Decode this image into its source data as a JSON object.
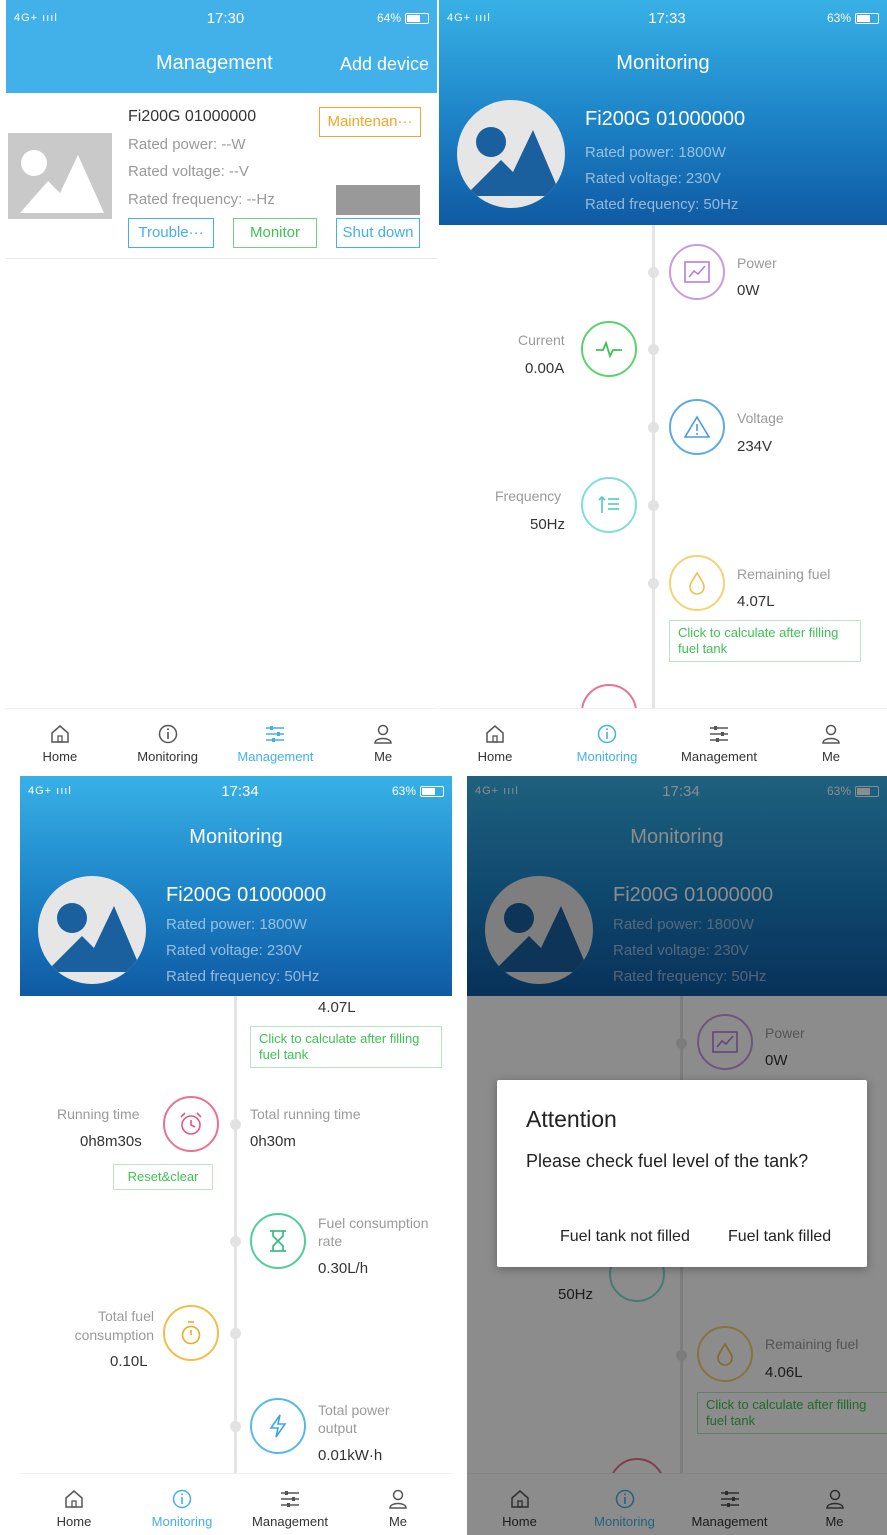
{
  "status": {
    "p1": {
      "signal": "4G+ ıııl",
      "time": "17:30",
      "battery": "64%"
    },
    "p2": {
      "signal": "4G+ ıııl",
      "time": "17:33",
      "battery": "63%"
    },
    "p3": {
      "signal": "4G+ ıııl",
      "time": "17:34",
      "battery": "63%"
    },
    "p4": {
      "signal": "4G+ ıııl",
      "time": "17:34",
      "battery": "63%"
    }
  },
  "colors": {
    "accent": "#42b1ea",
    "orange": "#f5a623",
    "green": "#3fc154"
  },
  "tabs": [
    "Home",
    "Monitoring",
    "Management",
    "Me"
  ],
  "management": {
    "title": "Management",
    "add_device": "Add device",
    "device_name": "Fi200G 01000000",
    "rated_power": "Rated power:  --W",
    "rated_voltage": "Rated voltage:  --V",
    "rated_frequency": "Rated frequency:  --Hz",
    "btn_maintenance": "Maintenan···",
    "btn_trouble": "Trouble···",
    "btn_monitor": "Monitor",
    "btn_shutdown": "Shut down"
  },
  "monitoring": {
    "title": "Monitoring",
    "device_name": "Fi200G 01000000",
    "rated_power": "Rated power:  1800W",
    "rated_voltage": "Rated voltage:  230V",
    "rated_frequency": "Rated frequency:  50Hz",
    "power_label": "Power",
    "power_value": "0W",
    "current_label": "Current",
    "current_value": "0.00A",
    "voltage_label": "Voltage",
    "voltage_value": "234V",
    "frequency_label": "Frequency",
    "frequency_value": "50Hz",
    "fuel_label": "Remaining fuel",
    "fuel_value": "4.07L",
    "fuel_value_p4": "4.06L",
    "calc_btn": "Click to calculate after filling fuel tank",
    "running_label": "Running time",
    "running_value": "0h8m30s",
    "reset_btn": "Reset&clear",
    "total_running_label": "Total running time",
    "total_running_value": "0h30m",
    "fcr_label": "Fuel consumption rate",
    "fcr_value": "0.30L/h",
    "tfc_label": "Total fuel consumption",
    "tfc_value": "0.10L",
    "tpo_label": "Total power output",
    "tpo_value": "0.01kW·h"
  },
  "dialog": {
    "title": "Attention",
    "message": "Please check fuel level of the tank?",
    "btn_not_filled": "Fuel tank not filled",
    "btn_filled": "Fuel tank filled"
  }
}
